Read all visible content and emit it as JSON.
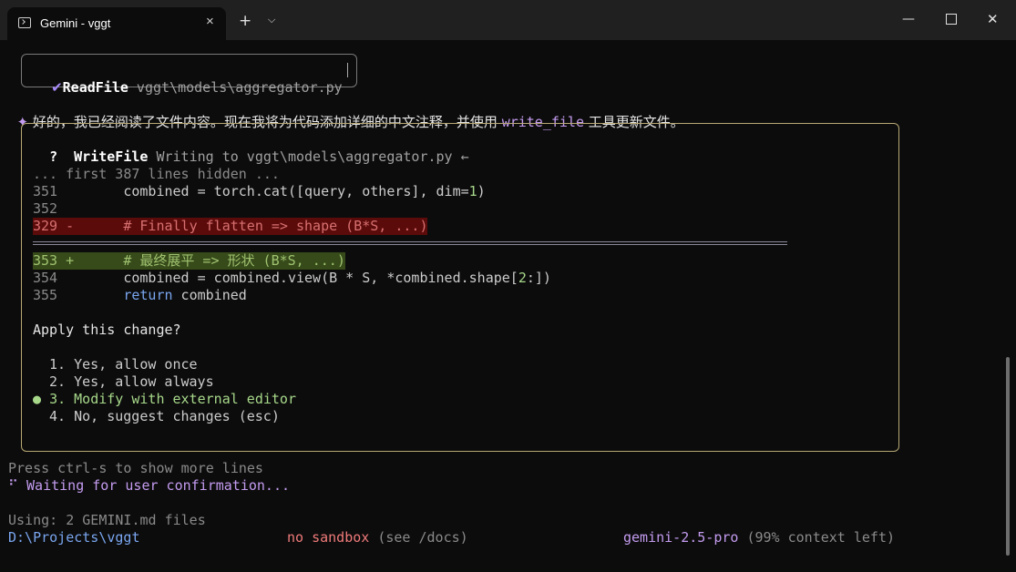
{
  "window": {
    "tab_title": "Gemini - vggt",
    "tab_close_icon": "×",
    "new_tab_icon": "+",
    "tab_dropdown_icon": "⌵",
    "minimize_icon": "—",
    "close_icon": "✕"
  },
  "readfile": {
    "check_icon": "✔",
    "tool": "ReadFile",
    "path": "vggt\\models\\aggregator.py"
  },
  "message": {
    "icon": "✦",
    "text_before": "好的，我已经阅读了文件内容。现在我将为代码添加详细的中文注释，并使用 ",
    "code": "write_file",
    "text_after": " 工具更新文件。"
  },
  "writefile": {
    "marker": "?",
    "tool": "WriteFile",
    "desc": "Writing to vggt\\models\\aggregator.py ←",
    "hidden_note": "... first 387 lines hidden ...",
    "diff": [
      {
        "num": "351",
        "sign": " ",
        "pre": "     combined = torch.cat([query, others], dim=",
        "num_lit": "1",
        "post": ")",
        "type": "ctx"
      },
      {
        "num": "352",
        "sign": " ",
        "pre": "",
        "num_lit": "",
        "post": "",
        "type": "ctx"
      },
      {
        "num": "329",
        "sign": "-",
        "text": "     # Finally flatten => shape (B*S, ...)",
        "type": "del"
      },
      {
        "num": "353",
        "sign": "+",
        "text": "     # 最终展平 => 形状 (B*S, ...)",
        "type": "add"
      },
      {
        "num": "354",
        "sign": " ",
        "pre": "     combined = combined.view(B * S, *combined.shape[",
        "num_lit": "2",
        "post": ":])",
        "type": "ctx"
      },
      {
        "num": "355",
        "sign": " ",
        "kw": "return",
        "post": " combined",
        "type": "ret"
      }
    ],
    "question": "Apply this change?",
    "options": [
      "1. Yes, allow once",
      "2. Yes, allow always",
      "3. Modify with external editor",
      "4. No, suggest changes (esc)"
    ],
    "selected_marker": "●"
  },
  "footer": {
    "hint": "Press ctrl-s to show more lines",
    "spinner": "⠋",
    "waiting": "Waiting for user confirmation...",
    "using": "Using: 2 GEMINI.md files",
    "cwd": "D:\\Projects\\vggt",
    "sandbox": "no sandbox",
    "sandbox_hint": "(see /docs)",
    "model": "gemini-2.5-pro",
    "context": "(99% context left)"
  }
}
